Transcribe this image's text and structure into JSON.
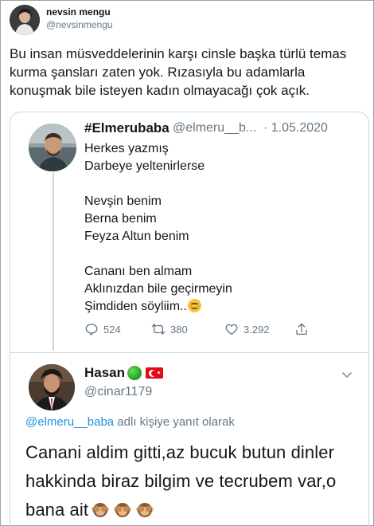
{
  "outer_tweet": {
    "name": "nevsin mengu",
    "handle": "@nevsinmengu",
    "text": "Bu insan müsveddelerinin karşı cinsle başka türlü temas kurma şansları zaten yok. Rızasıyla bu adamlarla konuşmak bile isteyen kadın olmayacağı çok açık."
  },
  "quoted_tweet": {
    "name": "#Elmerubaba",
    "handle": "@elmeru__b...",
    "date": "· 1.05.2020",
    "text": "Herkes yazmış\nDarbeye yeltenirlerse\n\nNevşin benim\nBerna benim\nFeyza Altun benim\n\nCananı ben almam\nAklınızdan bile geçirmeyin\nŞimdiden söyliim..",
    "emoji": "smiling-face-icon",
    "replies": "524",
    "retweets": "380",
    "likes": "3.292"
  },
  "reply_tweet": {
    "name": "Hasan",
    "handle": "@cinar1179",
    "reply_prefix": "@elmeru__baba",
    "reply_suffix": " adlı kişiye yanıt olarak",
    "text": "Canani aldim gitti,az bucuk butun dinler hakkinda biraz bilgim ve tecrubem var,o bana ait",
    "emoji_count": 3
  },
  "colors": {
    "text": "#14171a",
    "secondary": "#657786",
    "link": "#1b95e0",
    "border": "#ccd6dd"
  }
}
